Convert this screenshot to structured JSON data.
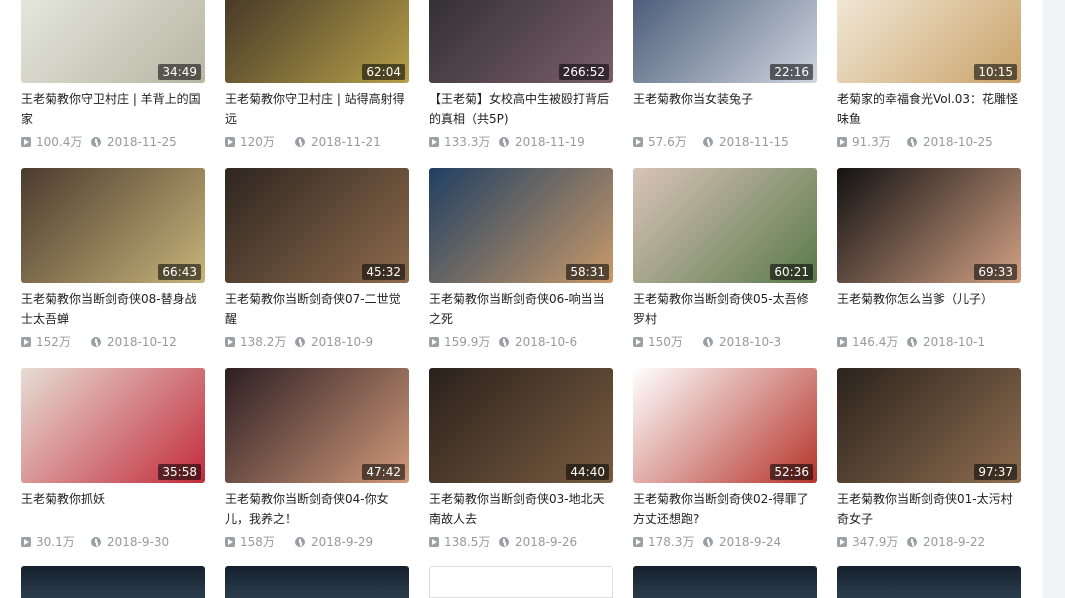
{
  "videos": [
    {
      "title": "王老菊教你守卫村庄 | 羊背上的国家",
      "duration": "34:49",
      "views": "100.4万",
      "date": "2018-11-25",
      "thumb_colors": [
        "#e9ece3",
        "#b8b5a3"
      ]
    },
    {
      "title": "王老菊教你守卫村庄 | 站得高射得远",
      "duration": "62:04",
      "views": "120万",
      "date": "2018-11-21",
      "thumb_colors": [
        "#3a2e24",
        "#b7a04a"
      ]
    },
    {
      "title": "【王老菊】女校高中生被殴打背后的真相（共5P)",
      "duration": "266:52",
      "views": "133.3万",
      "date": "2018-11-19",
      "thumb_colors": [
        "#2b2b2e",
        "#7a5f6b"
      ]
    },
    {
      "title": "王老菊教你当女装兔子",
      "duration": "22:16",
      "views": "57.6万",
      "date": "2018-11-15",
      "thumb_colors": [
        "#3e4f6e",
        "#cfd6df"
      ]
    },
    {
      "title": "老菊家的幸福食光Vol.03：花雕怪味鱼",
      "duration": "10:15",
      "views": "91.3万",
      "date": "2018-10-25",
      "thumb_colors": [
        "#f4eee0",
        "#caa36a"
      ]
    },
    {
      "title": "王老菊教你当断剑奇侠08-替身战士太吾蝉",
      "duration": "66:43",
      "views": "152万",
      "date": "2018-10-12",
      "thumb_colors": [
        "#4b3b2e",
        "#c8b47a"
      ]
    },
    {
      "title": "王老菊教你当断剑奇侠07-二世觉醒",
      "duration": "45:32",
      "views": "138.2万",
      "date": "2018-10-9",
      "thumb_colors": [
        "#2e2620",
        "#8d6a4b"
      ]
    },
    {
      "title": "王老菊教你当断剑奇侠06-响当当之死",
      "duration": "58:31",
      "views": "159.9万",
      "date": "2018-10-6",
      "thumb_colors": [
        "#1f3f62",
        "#c99a6a"
      ]
    },
    {
      "title": "王老菊教你当断剑奇侠05-太吾修罗村",
      "duration": "60:21",
      "views": "150万",
      "date": "2018-10-3",
      "thumb_colors": [
        "#d9c3b8",
        "#5a7a4a"
      ]
    },
    {
      "title": "王老菊教你怎么当爹（儿子）",
      "duration": "69:33",
      "views": "146.4万",
      "date": "2018-10-1",
      "thumb_colors": [
        "#121212",
        "#d3a184"
      ]
    },
    {
      "title": "王老菊教你抓妖",
      "duration": "35:58",
      "views": "30.1万",
      "date": "2018-9-30",
      "thumb_colors": [
        "#e7ddd4",
        "#c22b3a"
      ]
    },
    {
      "title": "王老菊教你当断剑奇侠04-你女儿，我养之！",
      "duration": "47:42",
      "views": "158万",
      "date": "2018-9-29",
      "thumb_colors": [
        "#2d1f24",
        "#d29a7a"
      ]
    },
    {
      "title": "王老菊教你当断剑奇侠03-地北天南故人去",
      "duration": "44:40",
      "views": "138.5万",
      "date": "2018-9-26",
      "thumb_colors": [
        "#2a211c",
        "#7a5c3f"
      ]
    },
    {
      "title": "王老菊教你当断剑奇侠02-得罪了方丈还想跑?",
      "duration": "52:36",
      "views": "178.3万",
      "date": "2018-9-24",
      "thumb_colors": [
        "#ffffff",
        "#b5342a"
      ]
    },
    {
      "title": "王老菊教你当断剑奇侠01-太污村奇女子",
      "duration": "97:37",
      "views": "347.9万",
      "date": "2018-9-22",
      "thumb_colors": [
        "#2b231d",
        "#8e6d4e"
      ]
    }
  ]
}
